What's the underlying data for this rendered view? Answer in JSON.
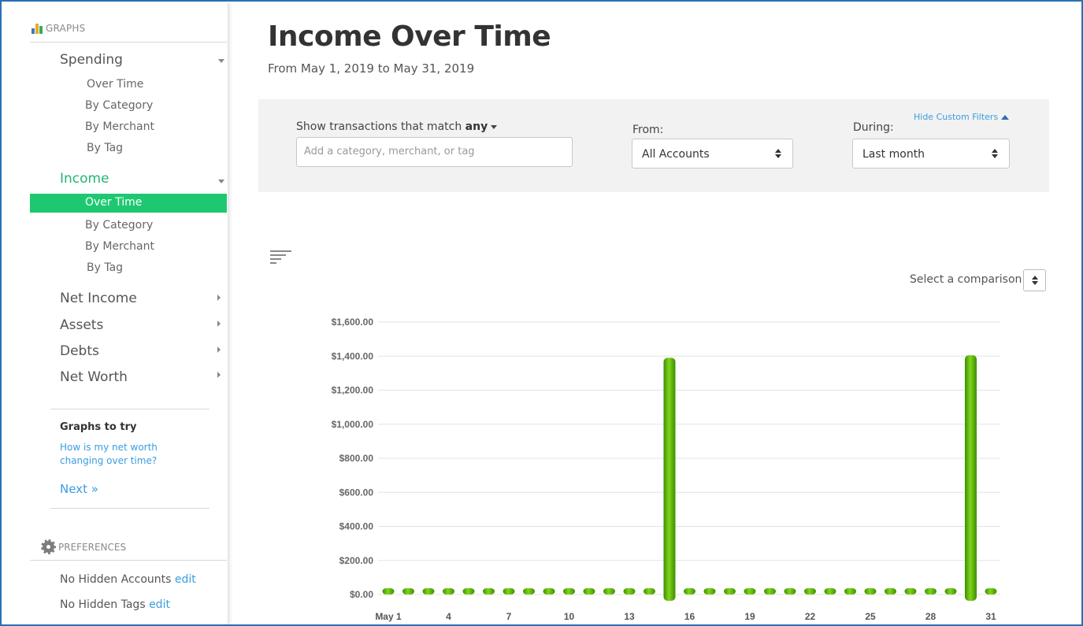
{
  "sidebar": {
    "graphs_header": "GRAPHS",
    "sections": {
      "spending": {
        "label": "Spending",
        "items": [
          "Over Time",
          "By Category",
          "By Merchant",
          "By Tag"
        ]
      },
      "income": {
        "label": "Income",
        "active_item": "Over Time",
        "items": [
          "By Category",
          "By Merchant",
          "By Tag"
        ]
      },
      "others": [
        "Net Income",
        "Assets",
        "Debts",
        "Net Worth"
      ]
    },
    "graphs_to_try": {
      "title": "Graphs to try",
      "link": "How is my net worth changing over time?",
      "next": "Next »"
    },
    "preferences": {
      "header": "PREFERENCES",
      "hidden_accounts": "No Hidden Accounts",
      "hidden_tags": "No Hidden Tags",
      "edit_label": "edit"
    }
  },
  "main": {
    "title": "Income Over Time",
    "subtitle": "From May 1, 2019 to May 31, 2019"
  },
  "filters": {
    "match_label": "Show transactions that match",
    "match_value": "any",
    "search_placeholder": "Add a category, merchant, or tag",
    "from_label": "From:",
    "from_value": "All Accounts",
    "during_label": "During:",
    "during_value": "Last month",
    "hide_custom_filters": "Hide Custom Filters"
  },
  "comparison": {
    "label": "Select a comparison"
  },
  "colors": {
    "accent_green": "#1ec871",
    "link_blue": "#3a9de0",
    "bar_green": "#5cb800"
  },
  "chart_data": {
    "type": "bar",
    "ylim": [
      0,
      1600
    ],
    "yticks": [
      "$0.00",
      "$200.00",
      "$400.00",
      "$600.00",
      "$800.00",
      "$1,000.00",
      "$1,200.00",
      "$1,400.00",
      "$1,600.00"
    ],
    "xtick_labels": [
      "May 1",
      "4",
      "7",
      "10",
      "13",
      "16",
      "19",
      "22",
      "25",
      "28",
      "31"
    ],
    "categories": [
      "1",
      "2",
      "3",
      "4",
      "5",
      "6",
      "7",
      "8",
      "9",
      "10",
      "11",
      "12",
      "13",
      "14",
      "15",
      "16",
      "17",
      "18",
      "19",
      "20",
      "21",
      "22",
      "23",
      "24",
      "25",
      "26",
      "27",
      "28",
      "29",
      "30",
      "31"
    ],
    "values": [
      0,
      0,
      0,
      0,
      0,
      0,
      0,
      0,
      0,
      0,
      0,
      0,
      0,
      0,
      1390,
      0,
      0,
      0,
      0,
      0,
      0,
      0,
      0,
      0,
      0,
      0,
      0,
      0,
      0,
      1405,
      0
    ]
  }
}
